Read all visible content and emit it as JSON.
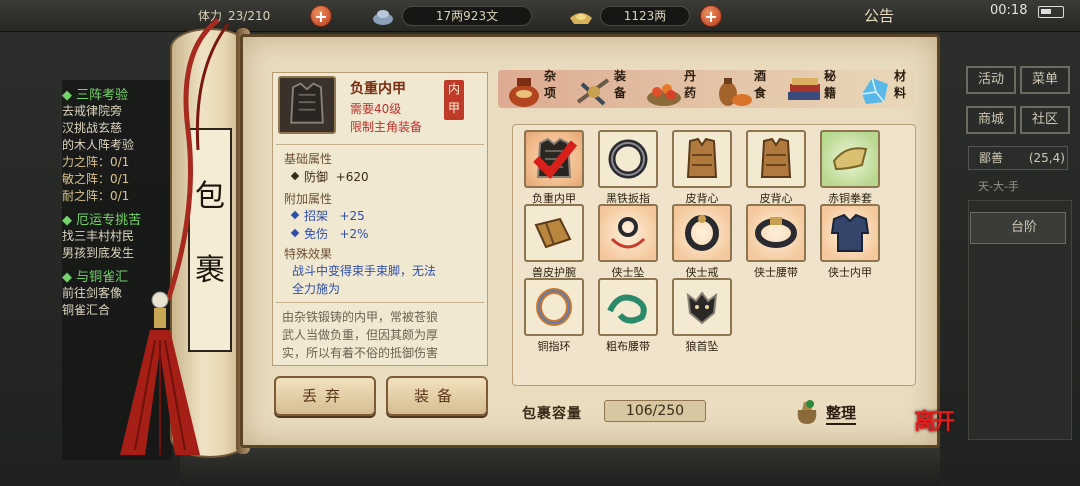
{
  "topbar": {
    "stamina_value": "23/210",
    "money_value": "17两923文",
    "silver_value": "1123两",
    "notice_label": "公告",
    "clock": "00:18"
  },
  "quests": {
    "q1_title": "三阵考验",
    "q1_lines": [
      "去戒律院旁",
      "汉挑战玄慈",
      "的木人阵考验"
    ],
    "q1_progress": [
      "力之阵：0/1",
      "敏之阵：0/1",
      "耐之阵：0/1"
    ],
    "q2_title": "厄运专挑苦",
    "q2_lines": [
      "找三丰村村民",
      "男孩到底发生"
    ],
    "q3_title": "与铜雀汇",
    "q3_lines": [
      "前往剑客像",
      "铜雀汇合"
    ]
  },
  "side": {
    "activity": "活动",
    "menu": "菜单",
    "shop": "商城",
    "community": "社区",
    "region": "鄙善",
    "region_coords": "(25,4)",
    "region_sub": "天-大-手",
    "stair": "台阶"
  },
  "scroll": {
    "title_1": "包",
    "title_2": "裹"
  },
  "detail": {
    "name": "负重内甲",
    "requirement": "需要40级",
    "restriction": "限制主角装备",
    "slot_tag": "内甲",
    "base_title": "基础属性",
    "base_attr": "防御",
    "base_value": "+620",
    "extra_title": "附加属性",
    "extra_1_name": "招架",
    "extra_1_value": "+25",
    "extra_2_name": "免伤",
    "extra_2_value": "+2%",
    "special_title": "特殊效果",
    "special_line_1": "战斗中变得束手束脚，无法",
    "special_line_2": "全力施为",
    "desc_line_1": "由杂铁锻铸的内甲，常被苍狼",
    "desc_line_2": "武人当做负重，但因其颇为厚",
    "desc_line_3": "实，所以有着不俗的抵御伤害"
  },
  "actions": {
    "discard": "丢弃",
    "equip": "装备"
  },
  "tabs": [
    {
      "label": "杂项",
      "icon": "jar-icon"
    },
    {
      "label": "装备",
      "icon": "weapon-icon"
    },
    {
      "label": "丹药",
      "icon": "pill-icon"
    },
    {
      "label": "酒食",
      "icon": "food-icon"
    },
    {
      "label": "秘籍",
      "icon": "book-icon"
    },
    {
      "label": "材料",
      "icon": "crystal-icon"
    }
  ],
  "items": [
    {
      "label": "负重内甲",
      "icon": "armor-vest-icon",
      "selected": true
    },
    {
      "label": "黑铁扳指",
      "icon": "ring-icon"
    },
    {
      "label": "皮背心",
      "icon": "leather-vest-icon"
    },
    {
      "label": "皮背心",
      "icon": "leather-vest-icon"
    },
    {
      "label": "赤铜拳套",
      "icon": "gauntlet-icon"
    },
    {
      "label": "兽皮护腕",
      "icon": "bracer-icon"
    },
    {
      "label": "侠士坠",
      "icon": "pendant-icon"
    },
    {
      "label": "侠士戒",
      "icon": "ring-icon"
    },
    {
      "label": "侠士腰带",
      "icon": "belt-icon"
    },
    {
      "label": "侠士内甲",
      "icon": "tunic-icon"
    },
    {
      "label": "铜指环",
      "icon": "ring-icon"
    },
    {
      "label": "粗布腰带",
      "icon": "cloth-belt-icon"
    },
    {
      "label": "狼首坠",
      "icon": "wolf-pendant-icon"
    }
  ],
  "capacity": {
    "label": "包裹容量",
    "value": "106/250"
  },
  "tidy_label": "整理",
  "leave_label": "离开",
  "colors": {
    "parchment": "#e9dcbf",
    "accent_red": "#c0302a",
    "attr_blue": "#2f4fa8",
    "frame_brown": "#8d7550"
  }
}
